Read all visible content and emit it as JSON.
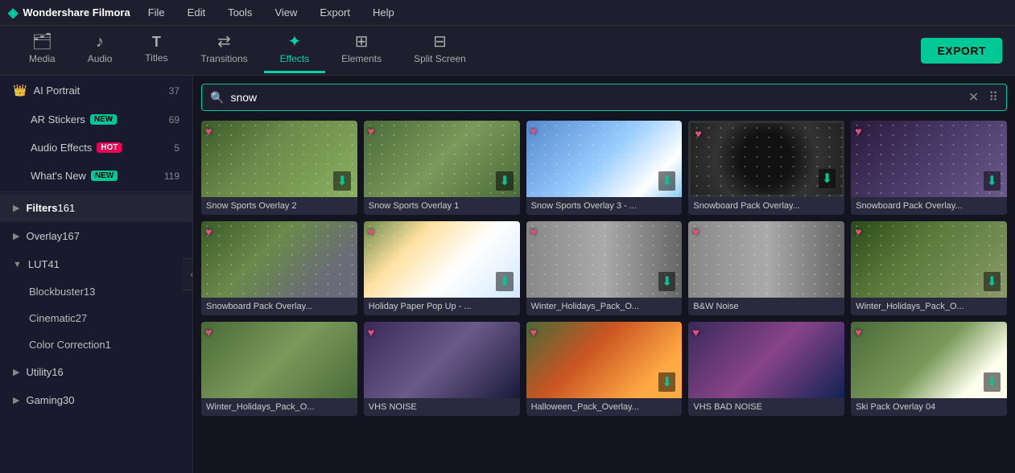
{
  "app": {
    "name": "Wondershare Filmora",
    "logo": "◈"
  },
  "menu": {
    "items": [
      "File",
      "Edit",
      "Tools",
      "View",
      "Export",
      "Help"
    ]
  },
  "toolbar": {
    "items": [
      {
        "id": "media",
        "label": "Media",
        "icon": "🗂"
      },
      {
        "id": "audio",
        "label": "Audio",
        "icon": "🎵"
      },
      {
        "id": "titles",
        "label": "Titles",
        "icon": "T"
      },
      {
        "id": "transitions",
        "label": "Transitions",
        "icon": "⟷"
      },
      {
        "id": "effects",
        "label": "Effects",
        "icon": "✦"
      },
      {
        "id": "elements",
        "label": "Elements",
        "icon": "⊞"
      },
      {
        "id": "splitscreen",
        "label": "Split Screen",
        "icon": "⊟"
      }
    ],
    "active": "effects",
    "export_label": "EXPORT"
  },
  "sidebar": {
    "items": [
      {
        "id": "ai-portrait",
        "label": "AI Portrait",
        "count": "37",
        "badge": null,
        "crown": true
      },
      {
        "id": "ar-stickers",
        "label": "AR Stickers",
        "count": "69",
        "badge": "new"
      },
      {
        "id": "audio-effects",
        "label": "Audio Effects",
        "count": "5",
        "badge": "hot"
      },
      {
        "id": "whats-new",
        "label": "What's New",
        "count": "119",
        "badge": "new"
      },
      {
        "id": "filters",
        "label": "Filters",
        "count": "161",
        "arrow": "▶",
        "active": true
      },
      {
        "id": "overlay",
        "label": "Overlay",
        "count": "167",
        "arrow": "▶"
      },
      {
        "id": "lut",
        "label": "LUT",
        "count": "41",
        "arrow": "▼",
        "expanded": true
      },
      {
        "id": "blockbuster",
        "label": "Blockbuster",
        "count": "13",
        "sub": true
      },
      {
        "id": "cinematic",
        "label": "Cinematic",
        "count": "27",
        "sub": true
      },
      {
        "id": "color-correction",
        "label": "Color Correction",
        "count": "1",
        "sub": true
      },
      {
        "id": "utility",
        "label": "Utility",
        "count": "16",
        "arrow": "▶"
      },
      {
        "id": "gaming",
        "label": "Gaming",
        "count": "30",
        "arrow": "▶"
      }
    ]
  },
  "search": {
    "placeholder": "Search",
    "value": "snow",
    "clear_icon": "✕",
    "grid_icon": "⠿"
  },
  "grid": {
    "items": [
      {
        "id": 1,
        "label": "Snow Sports Overlay 2",
        "thumb_class": "tb1",
        "has_heart": true,
        "has_download": true
      },
      {
        "id": 2,
        "label": "Snow Sports Overlay 1",
        "thumb_class": "tb2",
        "has_heart": true,
        "has_download": true
      },
      {
        "id": 3,
        "label": "Snow Sports Overlay 3 - ...",
        "thumb_class": "tb3",
        "has_heart": true,
        "has_download": true
      },
      {
        "id": 4,
        "label": "Snowboard Pack Overlay...",
        "thumb_class": "tb4",
        "has_heart": true,
        "has_download": true
      },
      {
        "id": 5,
        "label": "Snowboard Pack Overlay...",
        "thumb_class": "tb5",
        "has_heart": true,
        "has_download": true
      },
      {
        "id": 6,
        "label": "Snowboard Pack Overlay...",
        "thumb_class": "tb6",
        "has_heart": true,
        "has_download": false
      },
      {
        "id": 7,
        "label": "Holiday Paper Pop Up - ...",
        "thumb_class": "tb7",
        "has_heart": true,
        "has_download": true
      },
      {
        "id": 8,
        "label": "Winter_Holidays_Pack_O...",
        "thumb_class": "tb8",
        "has_heart": true,
        "has_download": true
      },
      {
        "id": 9,
        "label": "B&W Noise",
        "thumb_class": "tb8",
        "has_heart": true,
        "has_download": false
      },
      {
        "id": 10,
        "label": "Winter_Holidays_Pack_O...",
        "thumb_class": "tb9",
        "has_heart": true,
        "has_download": true
      },
      {
        "id": 11,
        "label": "Winter_Holidays_Pack_O...",
        "thumb_class": "tb2",
        "has_heart": true,
        "has_download": false
      },
      {
        "id": 12,
        "label": "VHS NOISE",
        "thumb_class": "tb10",
        "has_heart": true,
        "has_download": false
      },
      {
        "id": 13,
        "label": "Halloween_Pack_Overlay...",
        "thumb_class": "tb11",
        "has_heart": true,
        "has_download": true
      },
      {
        "id": 14,
        "label": "VHS BAD NOISE",
        "thumb_class": "tb12",
        "has_heart": true,
        "has_download": false
      },
      {
        "id": 15,
        "label": "Ski Pack Overlay 04",
        "thumb_class": "tb13",
        "has_heart": true,
        "has_download": true
      }
    ]
  }
}
